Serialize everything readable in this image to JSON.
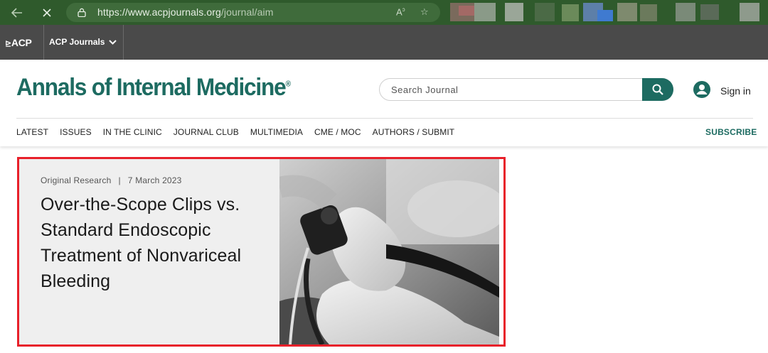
{
  "browser": {
    "url_main": "https://www.acpjournals.org",
    "url_path": "/journal/aim",
    "back_icon": "back-arrow-icon",
    "stop_icon": "close-icon",
    "reader_icon": "read-aloud-icon",
    "favorite_icon": "add-favorite-icon"
  },
  "acp_bar": {
    "logo": "ACP",
    "journals_label": "ACP Journals"
  },
  "header": {
    "brand": "Annals of Internal Medicine",
    "brand_mark": "®",
    "search_placeholder": "Search Journal",
    "signin": "Sign in",
    "nav": [
      "LATEST",
      "ISSUES",
      "IN THE CLINIC",
      "JOURNAL CLUB",
      "MULTIMEDIA",
      "CME / MOC",
      "AUTHORS / SUBMIT"
    ],
    "subscribe": "SUBSCRIBE"
  },
  "feature": {
    "category": "Original Research",
    "separator": "|",
    "date": "7 March 2023",
    "headline": "Over-the-Scope Clips vs. Standard Endoscopic Treatment of Nonvariceal Bleeding",
    "image_icon": "endoscope-photo"
  },
  "colors": {
    "brand_teal": "#1d6b61",
    "browser_green": "#2f5a2c",
    "acp_bar": "#4a4a4a",
    "highlight_red": "#e8202a"
  }
}
